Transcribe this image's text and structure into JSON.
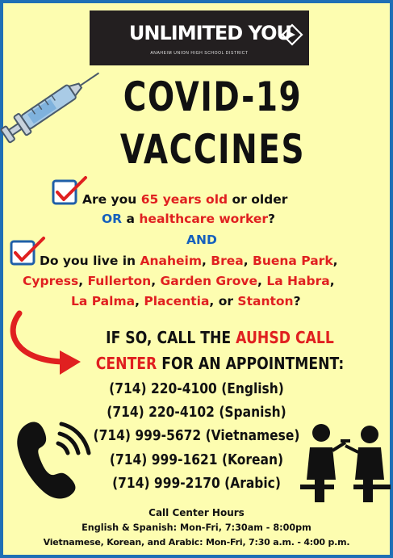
{
  "logo": {
    "brand": "UNLIMITED YOU",
    "district": "ANAHEIM UNION HIGH SCHOOL DISTRICT"
  },
  "title": {
    "line1": "COVID-19",
    "line2": "VACCINES"
  },
  "question1": {
    "part1": "Are you ",
    "age": "65 years old",
    "part2": " or older",
    "or": "OR",
    "part3": " a ",
    "worker": "healthcare worker",
    "part4": "?"
  },
  "and_text": "AND",
  "question2": {
    "intro": "Do you live in ",
    "cities": [
      "Anaheim",
      "Brea",
      "Buena Park",
      "Cypress",
      "Fullerton",
      "Garden Grove",
      "La Habra",
      "La Palma",
      "Placentia",
      "Stanton"
    ],
    "sep": ", ",
    "or_text": ", or ",
    "end": "?"
  },
  "call": {
    "part1": "If so, Call the ",
    "highlight1": "AUHSD Call",
    "highlight2": "Center",
    "part2": " for an appointment:"
  },
  "phones": [
    "(714) 220-4100 (English)",
    "(714) 220-4102 (Spanish)",
    "(714) 999-5672 (Vietnamese)",
    "(714) 999-1621 (Korean)",
    "(714) 999-2170 (Arabic)"
  ],
  "hours": {
    "title": "Call Center Hours",
    "line1": "English & Spanish: Mon-Fri, 7:30am - 8:00pm",
    "line2": "Vietnamese, Korean, and Arabic: Mon-Fri, 7:30 a.m. - 4:00 p.m."
  },
  "colors": {
    "background": "#fdfdb0",
    "border": "#1f6fb5",
    "accent_red": "#e02020",
    "accent_blue": "#1560bd"
  },
  "icons": [
    "syringe-icon",
    "checkbox-icon",
    "curved-arrow-icon",
    "phone-icon",
    "vaccination-icon"
  ]
}
